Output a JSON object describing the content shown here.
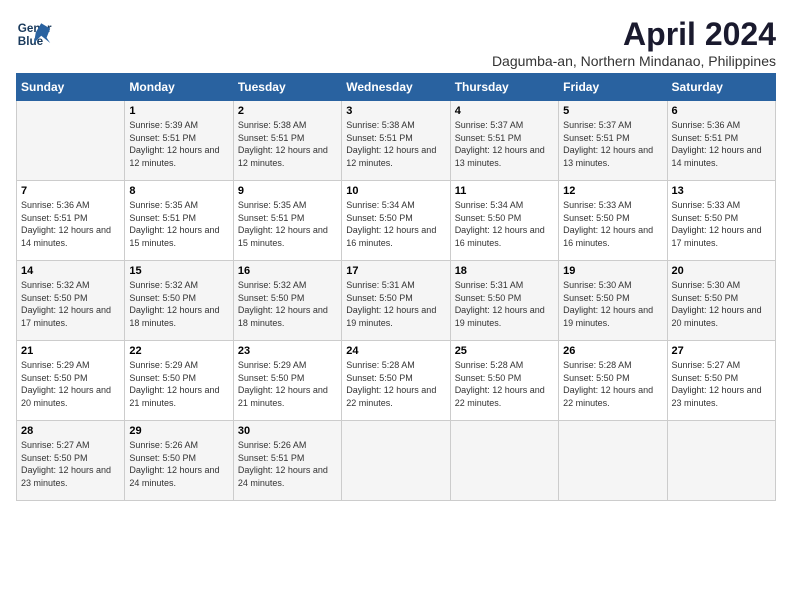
{
  "logo": {
    "line1": "General",
    "line2": "Blue"
  },
  "title": "April 2024",
  "location": "Dagumba-an, Northern Mindanao, Philippines",
  "days_header": [
    "Sunday",
    "Monday",
    "Tuesday",
    "Wednesday",
    "Thursday",
    "Friday",
    "Saturday"
  ],
  "weeks": [
    [
      {
        "day": "",
        "sunrise": "",
        "sunset": "",
        "daylight": ""
      },
      {
        "day": "1",
        "sunrise": "Sunrise: 5:39 AM",
        "sunset": "Sunset: 5:51 PM",
        "daylight": "Daylight: 12 hours and 12 minutes."
      },
      {
        "day": "2",
        "sunrise": "Sunrise: 5:38 AM",
        "sunset": "Sunset: 5:51 PM",
        "daylight": "Daylight: 12 hours and 12 minutes."
      },
      {
        "day": "3",
        "sunrise": "Sunrise: 5:38 AM",
        "sunset": "Sunset: 5:51 PM",
        "daylight": "Daylight: 12 hours and 12 minutes."
      },
      {
        "day": "4",
        "sunrise": "Sunrise: 5:37 AM",
        "sunset": "Sunset: 5:51 PM",
        "daylight": "Daylight: 12 hours and 13 minutes."
      },
      {
        "day": "5",
        "sunrise": "Sunrise: 5:37 AM",
        "sunset": "Sunset: 5:51 PM",
        "daylight": "Daylight: 12 hours and 13 minutes."
      },
      {
        "day": "6",
        "sunrise": "Sunrise: 5:36 AM",
        "sunset": "Sunset: 5:51 PM",
        "daylight": "Daylight: 12 hours and 14 minutes."
      }
    ],
    [
      {
        "day": "7",
        "sunrise": "Sunrise: 5:36 AM",
        "sunset": "Sunset: 5:51 PM",
        "daylight": "Daylight: 12 hours and 14 minutes."
      },
      {
        "day": "8",
        "sunrise": "Sunrise: 5:35 AM",
        "sunset": "Sunset: 5:51 PM",
        "daylight": "Daylight: 12 hours and 15 minutes."
      },
      {
        "day": "9",
        "sunrise": "Sunrise: 5:35 AM",
        "sunset": "Sunset: 5:51 PM",
        "daylight": "Daylight: 12 hours and 15 minutes."
      },
      {
        "day": "10",
        "sunrise": "Sunrise: 5:34 AM",
        "sunset": "Sunset: 5:50 PM",
        "daylight": "Daylight: 12 hours and 16 minutes."
      },
      {
        "day": "11",
        "sunrise": "Sunrise: 5:34 AM",
        "sunset": "Sunset: 5:50 PM",
        "daylight": "Daylight: 12 hours and 16 minutes."
      },
      {
        "day": "12",
        "sunrise": "Sunrise: 5:33 AM",
        "sunset": "Sunset: 5:50 PM",
        "daylight": "Daylight: 12 hours and 16 minutes."
      },
      {
        "day": "13",
        "sunrise": "Sunrise: 5:33 AM",
        "sunset": "Sunset: 5:50 PM",
        "daylight": "Daylight: 12 hours and 17 minutes."
      }
    ],
    [
      {
        "day": "14",
        "sunrise": "Sunrise: 5:32 AM",
        "sunset": "Sunset: 5:50 PM",
        "daylight": "Daylight: 12 hours and 17 minutes."
      },
      {
        "day": "15",
        "sunrise": "Sunrise: 5:32 AM",
        "sunset": "Sunset: 5:50 PM",
        "daylight": "Daylight: 12 hours and 18 minutes."
      },
      {
        "day": "16",
        "sunrise": "Sunrise: 5:32 AM",
        "sunset": "Sunset: 5:50 PM",
        "daylight": "Daylight: 12 hours and 18 minutes."
      },
      {
        "day": "17",
        "sunrise": "Sunrise: 5:31 AM",
        "sunset": "Sunset: 5:50 PM",
        "daylight": "Daylight: 12 hours and 19 minutes."
      },
      {
        "day": "18",
        "sunrise": "Sunrise: 5:31 AM",
        "sunset": "Sunset: 5:50 PM",
        "daylight": "Daylight: 12 hours and 19 minutes."
      },
      {
        "day": "19",
        "sunrise": "Sunrise: 5:30 AM",
        "sunset": "Sunset: 5:50 PM",
        "daylight": "Daylight: 12 hours and 19 minutes."
      },
      {
        "day": "20",
        "sunrise": "Sunrise: 5:30 AM",
        "sunset": "Sunset: 5:50 PM",
        "daylight": "Daylight: 12 hours and 20 minutes."
      }
    ],
    [
      {
        "day": "21",
        "sunrise": "Sunrise: 5:29 AM",
        "sunset": "Sunset: 5:50 PM",
        "daylight": "Daylight: 12 hours and 20 minutes."
      },
      {
        "day": "22",
        "sunrise": "Sunrise: 5:29 AM",
        "sunset": "Sunset: 5:50 PM",
        "daylight": "Daylight: 12 hours and 21 minutes."
      },
      {
        "day": "23",
        "sunrise": "Sunrise: 5:29 AM",
        "sunset": "Sunset: 5:50 PM",
        "daylight": "Daylight: 12 hours and 21 minutes."
      },
      {
        "day": "24",
        "sunrise": "Sunrise: 5:28 AM",
        "sunset": "Sunset: 5:50 PM",
        "daylight": "Daylight: 12 hours and 22 minutes."
      },
      {
        "day": "25",
        "sunrise": "Sunrise: 5:28 AM",
        "sunset": "Sunset: 5:50 PM",
        "daylight": "Daylight: 12 hours and 22 minutes."
      },
      {
        "day": "26",
        "sunrise": "Sunrise: 5:28 AM",
        "sunset": "Sunset: 5:50 PM",
        "daylight": "Daylight: 12 hours and 22 minutes."
      },
      {
        "day": "27",
        "sunrise": "Sunrise: 5:27 AM",
        "sunset": "Sunset: 5:50 PM",
        "daylight": "Daylight: 12 hours and 23 minutes."
      }
    ],
    [
      {
        "day": "28",
        "sunrise": "Sunrise: 5:27 AM",
        "sunset": "Sunset: 5:50 PM",
        "daylight": "Daylight: 12 hours and 23 minutes."
      },
      {
        "day": "29",
        "sunrise": "Sunrise: 5:26 AM",
        "sunset": "Sunset: 5:50 PM",
        "daylight": "Daylight: 12 hours and 24 minutes."
      },
      {
        "day": "30",
        "sunrise": "Sunrise: 5:26 AM",
        "sunset": "Sunset: 5:51 PM",
        "daylight": "Daylight: 12 hours and 24 minutes."
      },
      {
        "day": "",
        "sunrise": "",
        "sunset": "",
        "daylight": ""
      },
      {
        "day": "",
        "sunrise": "",
        "sunset": "",
        "daylight": ""
      },
      {
        "day": "",
        "sunrise": "",
        "sunset": "",
        "daylight": ""
      },
      {
        "day": "",
        "sunrise": "",
        "sunset": "",
        "daylight": ""
      }
    ]
  ]
}
